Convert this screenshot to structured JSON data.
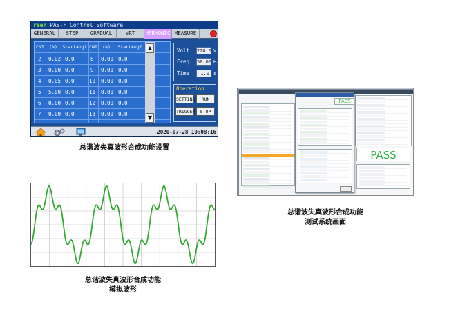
{
  "panel": {
    "brand": "reen",
    "app_title": "PAS-F Control Software",
    "tabs": [
      "GENERAL",
      "STEP",
      "GRADUAL",
      "VRT",
      "HARMONIC",
      "MEASURE"
    ],
    "active_tab": "HARMONIC",
    "table": {
      "headers": [
        "CNT",
        "(%)",
        "StartAng?",
        "CNT",
        "(%)",
        "StartAng?"
      ],
      "rows": [
        {
          "cnt_a": "2",
          "pct_a": "0.02",
          "ang_a": "0.0",
          "cnt_b": "8",
          "pct_b": "0.00",
          "ang_b": "0.0"
        },
        {
          "cnt_a": "3",
          "pct_a": "0.00",
          "ang_a": "0.0",
          "cnt_b": "9",
          "pct_b": "0.00",
          "ang_b": "0.0"
        },
        {
          "cnt_a": "4",
          "pct_a": "0.05",
          "ang_a": "0.0",
          "cnt_b": "10",
          "pct_b": "0.00",
          "ang_b": "0.0"
        },
        {
          "cnt_a": "5",
          "pct_a": "5.00",
          "ang_a": "0.0",
          "cnt_b": "11",
          "pct_b": "0.00",
          "ang_b": "0.0"
        },
        {
          "cnt_a": "6",
          "pct_a": "0.00",
          "ang_a": "0.0",
          "cnt_b": "12",
          "pct_b": "0.00",
          "ang_b": "0.0"
        },
        {
          "cnt_a": "7",
          "pct_a": "0.00",
          "ang_a": "0.0",
          "cnt_b": "13",
          "pct_b": "0.00",
          "ang_b": "0.0"
        }
      ],
      "scroll_up": "▲",
      "scroll_down": "▼"
    },
    "params": {
      "volt_label": "Volt.",
      "volt_value": "220.0",
      "volt_unit": "V",
      "freq_label": "Freq.",
      "freq_value": "50.00",
      "freq_unit": "Hz",
      "time_label": "Time",
      "time_value": "1.0",
      "time_unit": "s"
    },
    "operation": {
      "title": "Operation",
      "setting": "SETTING",
      "run": "RUN",
      "trigger": "TRIGGER",
      "stop": "STOP"
    },
    "datetime": "2020-07-28 10:08:16",
    "icons": [
      "home-icon",
      "settings-gears-icon",
      "display-icon",
      "power-icon"
    ]
  },
  "captions": {
    "settings": "总谐波失真波形合成功能设置",
    "wave_line1": "总谐波失真波形合成功能",
    "wave_line2": "模拟波形",
    "test_line1": "总谐波失真波形合成功能",
    "test_line2": "测试系统画面"
  },
  "test_screen": {
    "pass_big": "PASS",
    "pass_small": "PASS"
  },
  "colors": {
    "panel_bg": "#1b4f9a",
    "grid_bg": "#2a6fd0",
    "active_tab": "#d7a0ff",
    "wave": "#33a833",
    "pass": "#38b04a"
  }
}
